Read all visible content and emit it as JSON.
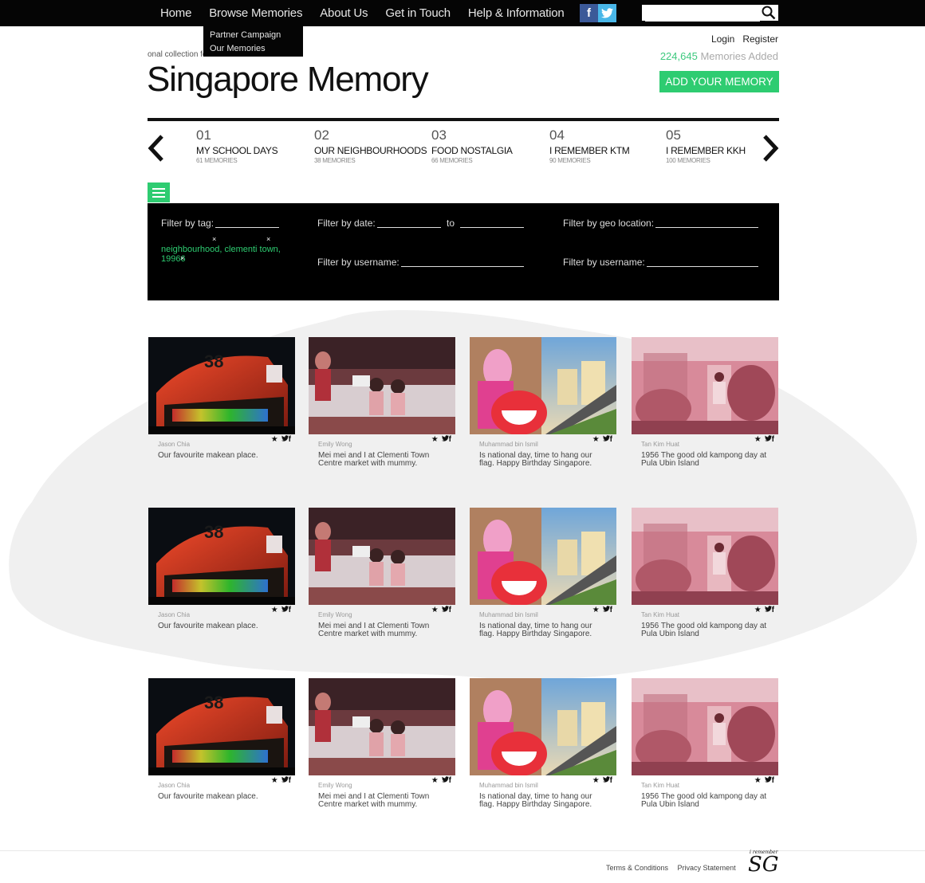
{
  "nav": {
    "items": [
      "Home",
      "Browse Memories",
      "About Us",
      "Get in Touch",
      "Help & Information"
    ],
    "dropdown": [
      "Partner Campaign",
      "Our Memories"
    ],
    "social": {
      "facebook": "f",
      "twitter": "t"
    },
    "search": {
      "value": "",
      "placeholder": ""
    }
  },
  "header": {
    "tagline": "onal collection for SG memories",
    "title": "Singapore Memory",
    "login": "Login",
    "register": "Register",
    "count": "224,645",
    "count_suffix": "Memories Added",
    "add_button": "ADD YOUR MEMORY"
  },
  "categories": [
    {
      "num": "01",
      "title": "MY SCHOOL DAYS",
      "count": "61 MEMORIES"
    },
    {
      "num": "02",
      "title": "OUR NEIGHBOURHOODS",
      "count": "38 MEMORIES"
    },
    {
      "num": "03",
      "title": "FOOD NOSTALGIA",
      "count": "66 MEMORIES"
    },
    {
      "num": "04",
      "title": "I REMEMBER KTM",
      "count": "90 MEMORIES"
    },
    {
      "num": "05",
      "title": "I REMEMBER KKH",
      "count": "100 MEMORIES"
    }
  ],
  "filters": {
    "tag": "Filter by tag:",
    "date": "Filter by date:",
    "to": "to",
    "geo": "Filter by geo location:",
    "username1": "Filter by username:",
    "username2": "Filter by username:",
    "active_tags_line1": "neighbourhood, clementi town,",
    "active_tags_line2": "19966",
    "remove": "×"
  },
  "cards": [
    {
      "author": "Jason Chia",
      "caption": "Our favourite makean place.",
      "icons": "★ ♥ f"
    },
    {
      "author": "Emily Wong",
      "caption": "Mei mei and I at Clementi Town Centre market with mummy.",
      "icons": "★ ♥ f"
    },
    {
      "author": "Muhammad bin Ismil",
      "caption": "Is national day, time to hang our flag. Happy Birthday Singapore.",
      "icons": "★ ♥ f"
    },
    {
      "author": "Tan Kim Huat",
      "caption": "1956 The good old kampong day at Pula Ubin Island",
      "icons": "★ ♥ f"
    }
  ],
  "footer": {
    "terms": "Terms & Conditions",
    "privacy": "Privacy Statement",
    "logo": "SG",
    "logo_small": "i remember"
  },
  "colors": {
    "accent": "#2ecc71",
    "nav_bg": "#050505",
    "filter_bg": "#000000"
  }
}
